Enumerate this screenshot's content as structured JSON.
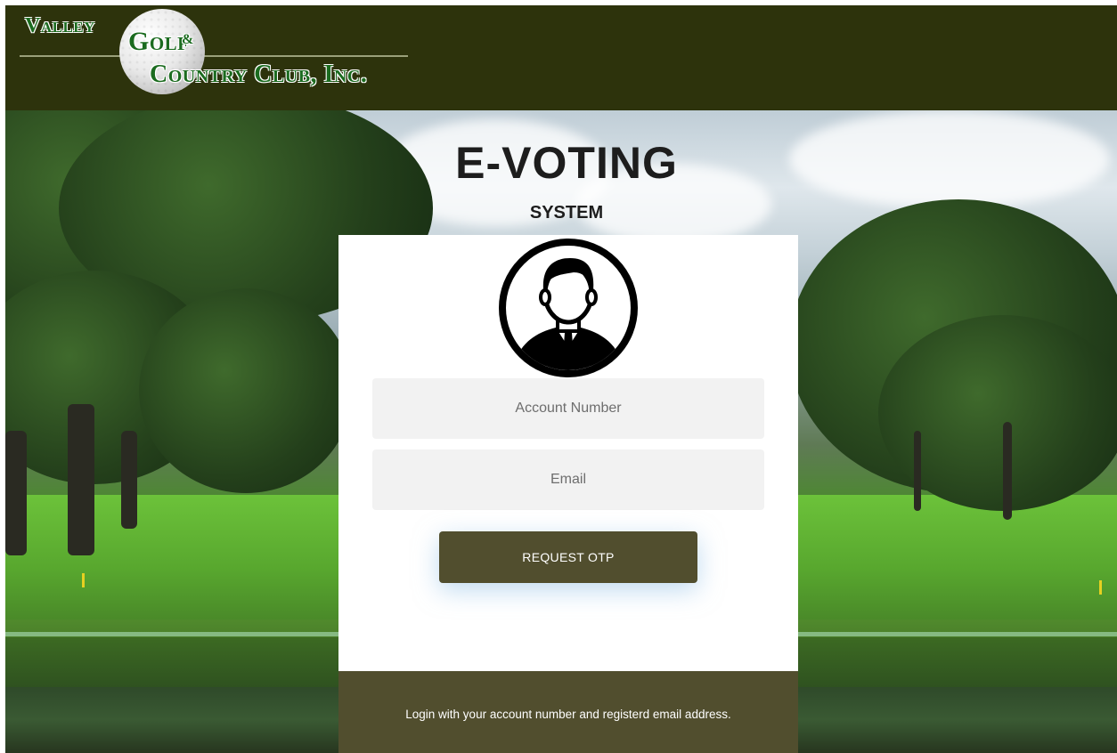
{
  "header": {
    "logo": {
      "line1": "Valley",
      "line2": "Golf",
      "amp": "&",
      "line3": "Country Club, Inc."
    }
  },
  "hero": {
    "title": "E-VOTING",
    "subtitle": "SYSTEM"
  },
  "login": {
    "avatar_icon": "user-avatar-icon",
    "account_placeholder": "Account Number",
    "account_value": "",
    "email_placeholder": "Email",
    "email_value": "",
    "submit_label": "REQUEST OTP",
    "footer_text": "Login with your account number and registerd email address."
  },
  "colors": {
    "header_bg": "#2d330c",
    "button_bg": "#514e2e",
    "footer_bg": "#514e2e",
    "field_bg": "#f2f2f2",
    "logo_green": "#1b6b1f"
  }
}
